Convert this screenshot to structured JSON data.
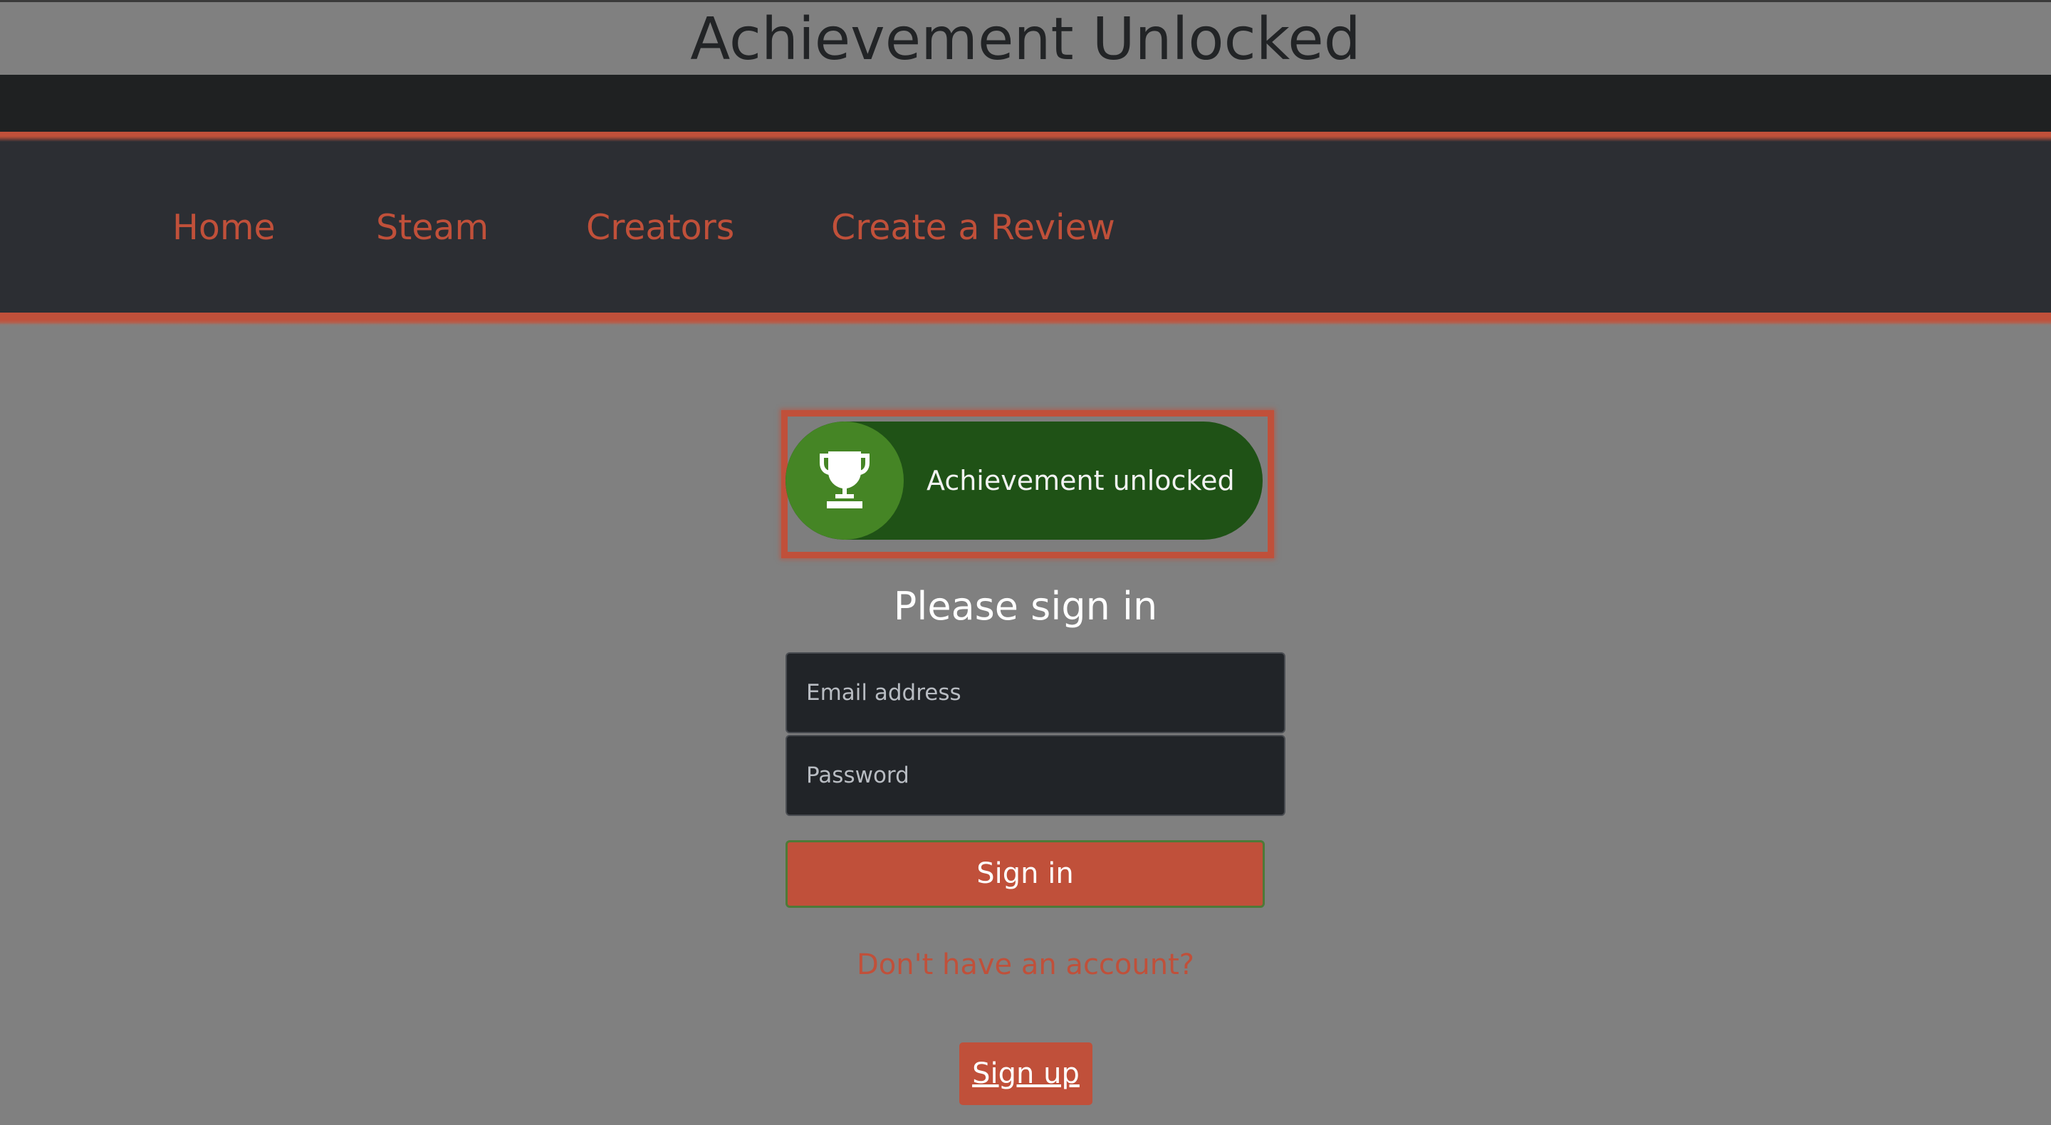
{
  "header": {
    "title": "Achievement Unlocked"
  },
  "nav": {
    "items": [
      {
        "label": "Home"
      },
      {
        "label": "Steam"
      },
      {
        "label": "Creators"
      },
      {
        "label": "Create a Review"
      }
    ]
  },
  "badge": {
    "text": "Achievement unlocked",
    "icon": "trophy-icon"
  },
  "signin": {
    "heading": "Please sign in",
    "email_placeholder": "Email address",
    "email_value": "",
    "password_placeholder": "Password",
    "password_value": "",
    "submit_label": "Sign in",
    "no_account_text": "Don't have an account?",
    "signup_label": "Sign up"
  },
  "colors": {
    "accent": "#c0503a",
    "page_background": "#808080",
    "nav_background": "#2c2e33",
    "badge_green": "#1f5216",
    "badge_circle": "#458525"
  }
}
